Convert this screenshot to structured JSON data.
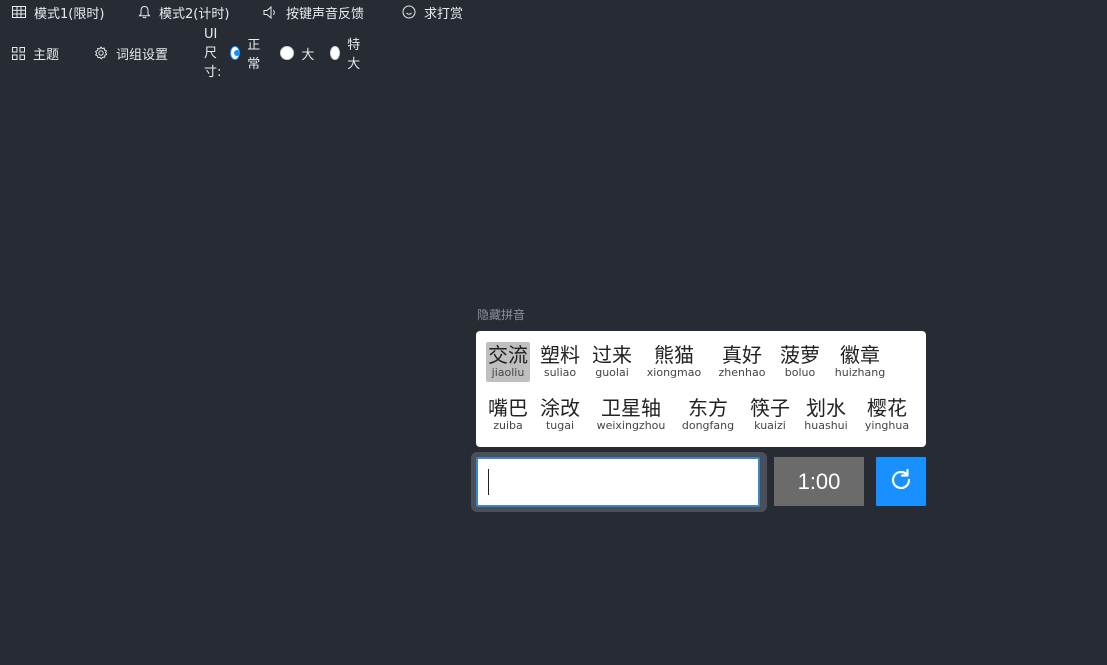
{
  "menu": {
    "mode1_label": "模式1(限时)",
    "mode2_label": "模式2(计时)",
    "sound_label": "按键声音反馈",
    "donate_label": "求打赏",
    "theme_label": "主题",
    "wordset_label": "词组设置",
    "uisize_label": "UI尺寸:",
    "size_options": [
      "正常",
      "大",
      "特大"
    ],
    "size_selected": "正常"
  },
  "practice": {
    "hint_label": "隐藏拼音",
    "words_row1": [
      {
        "hz": "交流",
        "py": "jiaoliu",
        "current": true
      },
      {
        "hz": "塑料",
        "py": "suliao"
      },
      {
        "hz": "过来",
        "py": "guolai"
      },
      {
        "hz": "熊猫",
        "py": "xiongmao"
      },
      {
        "hz": "真好",
        "py": "zhenhao"
      },
      {
        "hz": "菠萝",
        "py": "boluo"
      },
      {
        "hz": "徽章",
        "py": "huizhang"
      }
    ],
    "words_row2": [
      {
        "hz": "嘴巴",
        "py": "zuiba"
      },
      {
        "hz": "涂改",
        "py": "tugai"
      },
      {
        "hz": "卫星轴",
        "py": "weixingzhou"
      },
      {
        "hz": "东方",
        "py": "dongfang"
      },
      {
        "hz": "筷子",
        "py": "kuaizi"
      },
      {
        "hz": "划水",
        "py": "huashui"
      },
      {
        "hz": "樱花",
        "py": "yinghua"
      }
    ],
    "input_value": "",
    "timer": "1:00"
  },
  "colors": {
    "background": "#272b33",
    "accent": "#1890ff",
    "timer_bg": "#6b6b6b",
    "current_word_bg": "#bfbfbf"
  }
}
